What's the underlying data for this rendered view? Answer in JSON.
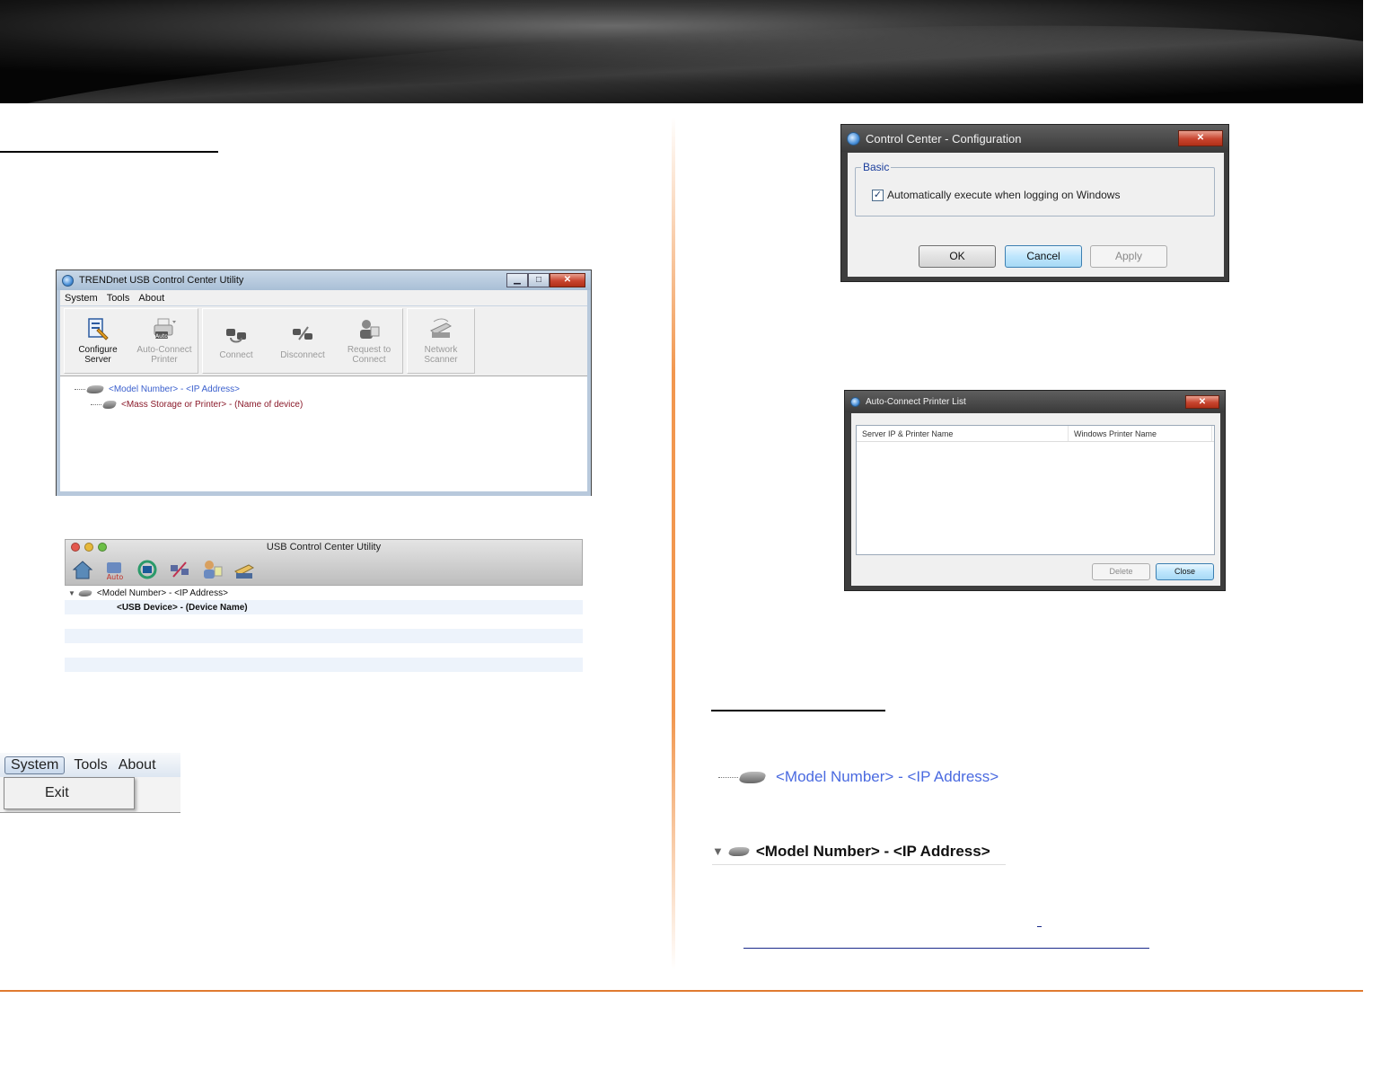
{
  "usb_utility_window": {
    "title": "TRENDnet USB Control Center Utility",
    "window_buttons": [
      "▁",
      "□",
      "✕"
    ],
    "menu": [
      "System",
      "Tools",
      "About"
    ],
    "toolbar": {
      "configure_server": [
        "Configure",
        "Server"
      ],
      "auto_connect_printer": [
        "Auto-Connect",
        "Printer"
      ],
      "connect": "Connect",
      "disconnect": "Disconnect",
      "request_to_connect": [
        "Request to",
        "Connect"
      ],
      "network_scanner": [
        "Network",
        "Scanner"
      ]
    },
    "tree": {
      "server": "<Model Number> - <IP Address>",
      "device": "<Mass Storage or Printer> - (Name of device)"
    }
  },
  "mac_window": {
    "title": "USB Control Center Utility",
    "auto_badge": "Auto",
    "server": "<Model Number> - <IP Address>",
    "device": "<USB Device> - (Device Name)"
  },
  "system_menu": {
    "items": [
      "System",
      "Tools",
      "About"
    ],
    "dropdown_item": "Exit"
  },
  "config_dialog": {
    "title": "Control Center - Configuration",
    "close_glyph": "✕",
    "group_label": "Basic",
    "checkbox_label": "Automatically execute when logging on Windows",
    "checkbox_checked": true,
    "ok": "OK",
    "cancel": "Cancel",
    "apply": "Apply"
  },
  "printer_list_dialog": {
    "title": "Auto-Connect Printer List",
    "close_glyph": "✕",
    "columns": [
      "Server IP & Printer Name",
      "Windows Printer Name"
    ],
    "delete": "Delete",
    "close": "Close"
  },
  "windows_server_entry": "<Model Number> - <IP Address>",
  "mac_server_entry": "<Model Number> - <IP Address>",
  "colors": {
    "accent_orange": "#e07a30",
    "server_blue": "#3a5fcd",
    "device_red": "#8a1a2a"
  }
}
